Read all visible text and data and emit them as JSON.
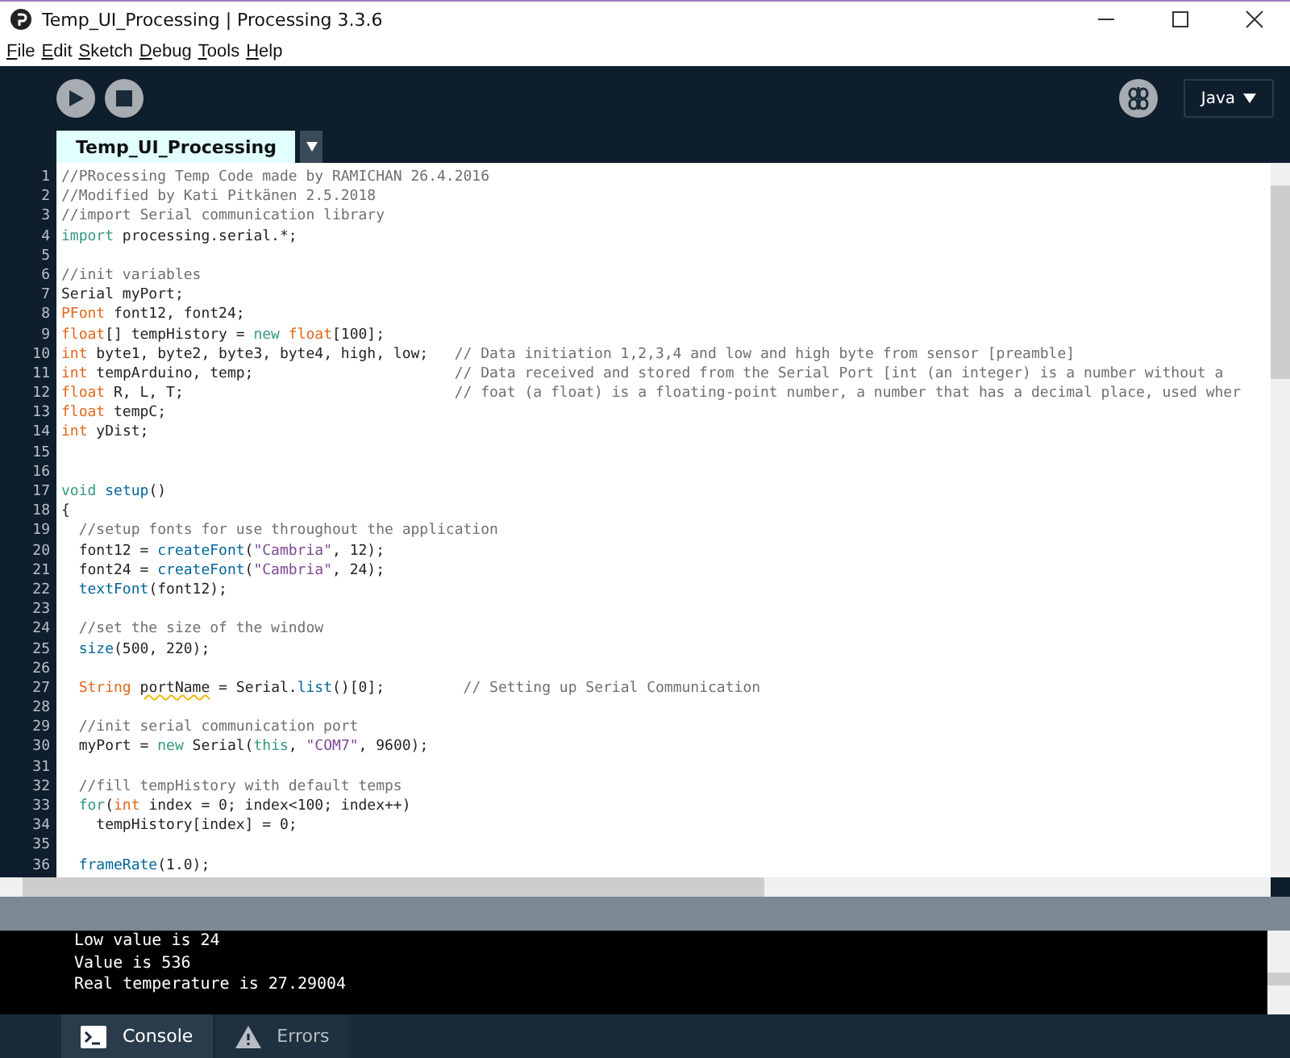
{
  "window": {
    "title": "Temp_UI_Processing | Processing 3.3.6"
  },
  "menu": [
    {
      "label": "File"
    },
    {
      "label": "Edit"
    },
    {
      "label": "Sketch"
    },
    {
      "label": "Debug"
    },
    {
      "label": "Tools"
    },
    {
      "label": "Help"
    }
  ],
  "toolbar": {
    "mode": "Java"
  },
  "tabs": [
    {
      "label": "Temp_UI_Processing",
      "selected": true
    }
  ],
  "editor": {
    "lines": [
      {
        "number": "1",
        "tokens": [
          {
            "kind": "comment",
            "text": "//PRocessing Temp Code made by RAMICHAN 26.4.2016"
          }
        ]
      },
      {
        "number": "2",
        "tokens": [
          {
            "kind": "comment",
            "text": "//Modified by Kati Pitkänen 2.5.2018"
          }
        ]
      },
      {
        "number": "3",
        "tokens": [
          {
            "kind": "comment",
            "text": "//import Serial communication library"
          }
        ]
      },
      {
        "number": "4",
        "tokens": [
          {
            "kind": "keyword",
            "text": "import"
          },
          {
            "kind": "plain",
            "text": " processing.serial.*;"
          }
        ]
      },
      {
        "number": "5"
      },
      {
        "number": "6",
        "tokens": [
          {
            "kind": "comment",
            "text": "//init variables"
          }
        ]
      },
      {
        "number": "7",
        "tokens": [
          {
            "kind": "plain",
            "text": "Serial myPort;"
          }
        ]
      },
      {
        "number": "8",
        "tokens": [
          {
            "kind": "type",
            "text": "PFont"
          },
          {
            "kind": "plain",
            "text": " font12, font24;"
          }
        ]
      },
      {
        "number": "9",
        "tokens": [
          {
            "kind": "type",
            "text": "float"
          },
          {
            "kind": "plain",
            "text": "[] tempHistory = "
          },
          {
            "kind": "keyword",
            "text": "new"
          },
          {
            "kind": "type",
            "text": " float"
          },
          {
            "kind": "plain",
            "text": "[100];"
          }
        ]
      },
      {
        "number": "10",
        "tokens": [
          {
            "kind": "type",
            "text": "int"
          },
          {
            "kind": "plain",
            "text": " byte1, byte2, byte3, byte4, high, low;   "
          },
          {
            "kind": "comment",
            "text": "// Data initiation 1,2,3,4 and low and high byte from sensor [preamble]"
          }
        ]
      },
      {
        "number": "11",
        "tokens": [
          {
            "kind": "type",
            "text": "int"
          },
          {
            "kind": "plain",
            "text": " tempArduino, temp;                       "
          },
          {
            "kind": "comment",
            "text": "// Data received and stored from the Serial Port [int (an integer) is a number without a"
          }
        ]
      },
      {
        "number": "12",
        "tokens": [
          {
            "kind": "type",
            "text": "float"
          },
          {
            "kind": "plain",
            "text": " R, L, T;                               "
          },
          {
            "kind": "comment",
            "text": "// foat (a float) is a floating-point number, a number that has a decimal place, used wher"
          }
        ]
      },
      {
        "number": "13",
        "tokens": [
          {
            "kind": "type",
            "text": "float"
          },
          {
            "kind": "plain",
            "text": " tempC;"
          }
        ]
      },
      {
        "number": "14",
        "tokens": [
          {
            "kind": "type",
            "text": "int"
          },
          {
            "kind": "plain",
            "text": " yDist;"
          }
        ]
      },
      {
        "number": "15"
      },
      {
        "number": "16"
      },
      {
        "number": "17",
        "tokens": [
          {
            "kind": "keyword",
            "text": "void"
          },
          {
            "kind": "function",
            "text": " setup"
          },
          {
            "kind": "plain",
            "text": "()"
          }
        ]
      },
      {
        "number": "18",
        "tokens": [
          {
            "kind": "plain",
            "text": "{"
          }
        ]
      },
      {
        "number": "19",
        "tokens": [
          {
            "kind": "comment",
            "text": "  //setup fonts for use throughout the application"
          }
        ]
      },
      {
        "number": "20",
        "tokens": [
          {
            "kind": "plain",
            "text": "  font12 = "
          },
          {
            "kind": "function",
            "text": "createFont"
          },
          {
            "kind": "plain",
            "text": "("
          },
          {
            "kind": "string",
            "text": "\"Cambria\""
          },
          {
            "kind": "plain",
            "text": ", 12);"
          }
        ]
      },
      {
        "number": "21",
        "tokens": [
          {
            "kind": "plain",
            "text": "  font24 = "
          },
          {
            "kind": "function",
            "text": "createFont"
          },
          {
            "kind": "plain",
            "text": "("
          },
          {
            "kind": "string",
            "text": "\"Cambria\""
          },
          {
            "kind": "plain",
            "text": ", 24);"
          }
        ]
      },
      {
        "number": "22",
        "tokens": [
          {
            "kind": "function",
            "text": "  textFont"
          },
          {
            "kind": "plain",
            "text": "(font12);"
          }
        ]
      },
      {
        "number": "23"
      },
      {
        "number": "24",
        "tokens": [
          {
            "kind": "comment",
            "text": "  //set the size of the window"
          }
        ]
      },
      {
        "number": "25",
        "tokens": [
          {
            "kind": "function",
            "text": "  size"
          },
          {
            "kind": "plain",
            "text": "(500, 220);"
          }
        ]
      },
      {
        "number": "26"
      },
      {
        "number": "27",
        "tokens": [
          {
            "kind": "type",
            "text": "  String "
          },
          {
            "kind": "warning",
            "text": "portName"
          },
          {
            "kind": "plain",
            "text": " = Serial."
          },
          {
            "kind": "function",
            "text": "list"
          },
          {
            "kind": "plain",
            "text": "()[0];         "
          },
          {
            "kind": "comment",
            "text": "// Setting up Serial Communication"
          }
        ]
      },
      {
        "number": "28"
      },
      {
        "number": "29",
        "tokens": [
          {
            "kind": "comment",
            "text": "  //init serial communication port"
          }
        ]
      },
      {
        "number": "30",
        "tokens": [
          {
            "kind": "plain",
            "text": "  myPort = "
          },
          {
            "kind": "keyword",
            "text": "new"
          },
          {
            "kind": "plain",
            "text": " Serial("
          },
          {
            "kind": "keyword",
            "text": "this"
          },
          {
            "kind": "plain",
            "text": ", "
          },
          {
            "kind": "string",
            "text": "\"COM7\""
          },
          {
            "kind": "plain",
            "text": ", 9600);"
          }
        ]
      },
      {
        "number": "31"
      },
      {
        "number": "32",
        "tokens": [
          {
            "kind": "comment",
            "text": "  //fill tempHistory with default temps"
          }
        ]
      },
      {
        "number": "33",
        "tokens": [
          {
            "kind": "keyword",
            "text": "  for"
          },
          {
            "kind": "plain",
            "text": "("
          },
          {
            "kind": "type",
            "text": "int"
          },
          {
            "kind": "plain",
            "text": " index = 0; index<100; index++)"
          }
        ]
      },
      {
        "number": "34",
        "tokens": [
          {
            "kind": "plain",
            "text": "    tempHistory[index] = 0;"
          }
        ]
      },
      {
        "number": "35"
      },
      {
        "number": "36",
        "tokens": [
          {
            "kind": "function",
            "text": "  frameRate"
          },
          {
            "kind": "plain",
            "text": "(1.0);"
          }
        ]
      }
    ]
  },
  "console": {
    "lines": [
      "Low value is 24",
      "Value is 536",
      "Real temperature is 27.29004"
    ]
  },
  "console_tabs": [
    {
      "label": "Console",
      "kind": "console",
      "selected": true
    },
    {
      "label": "Errors",
      "kind": "errors",
      "selected": false
    }
  ]
}
